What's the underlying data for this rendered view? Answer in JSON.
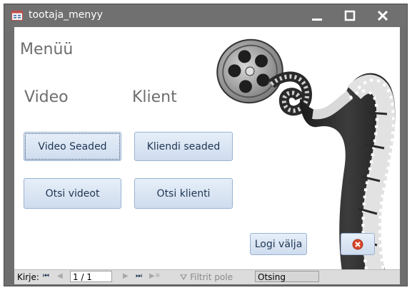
{
  "window": {
    "title": "tootaja_menyy"
  },
  "form": {
    "title": "Menüü",
    "video_heading": "Video",
    "klient_heading": "Klient",
    "buttons": {
      "video_settings": "Video Seaded",
      "client_settings": "Kliendi seaded",
      "search_videos": "Otsi videot",
      "search_clients": "Otsi klienti",
      "logout": "Logi välja"
    }
  },
  "statusbar": {
    "record_label": "Kirje:",
    "record_value": "1 / 1",
    "filter_label": "Filtrit pole",
    "search_placeholder": "Otsing"
  },
  "colors": {
    "titlebar": "#707070",
    "button_border": "#9bb2d2",
    "close_icon_red": "#d9472b"
  },
  "icons": [
    "form-icon",
    "minimize-icon",
    "maximize-icon",
    "close-icon",
    "film-reel-image",
    "close-circle-icon",
    "first-record-icon",
    "prev-record-icon",
    "next-record-icon",
    "last-record-icon",
    "new-record-icon",
    "filter-icon"
  ]
}
